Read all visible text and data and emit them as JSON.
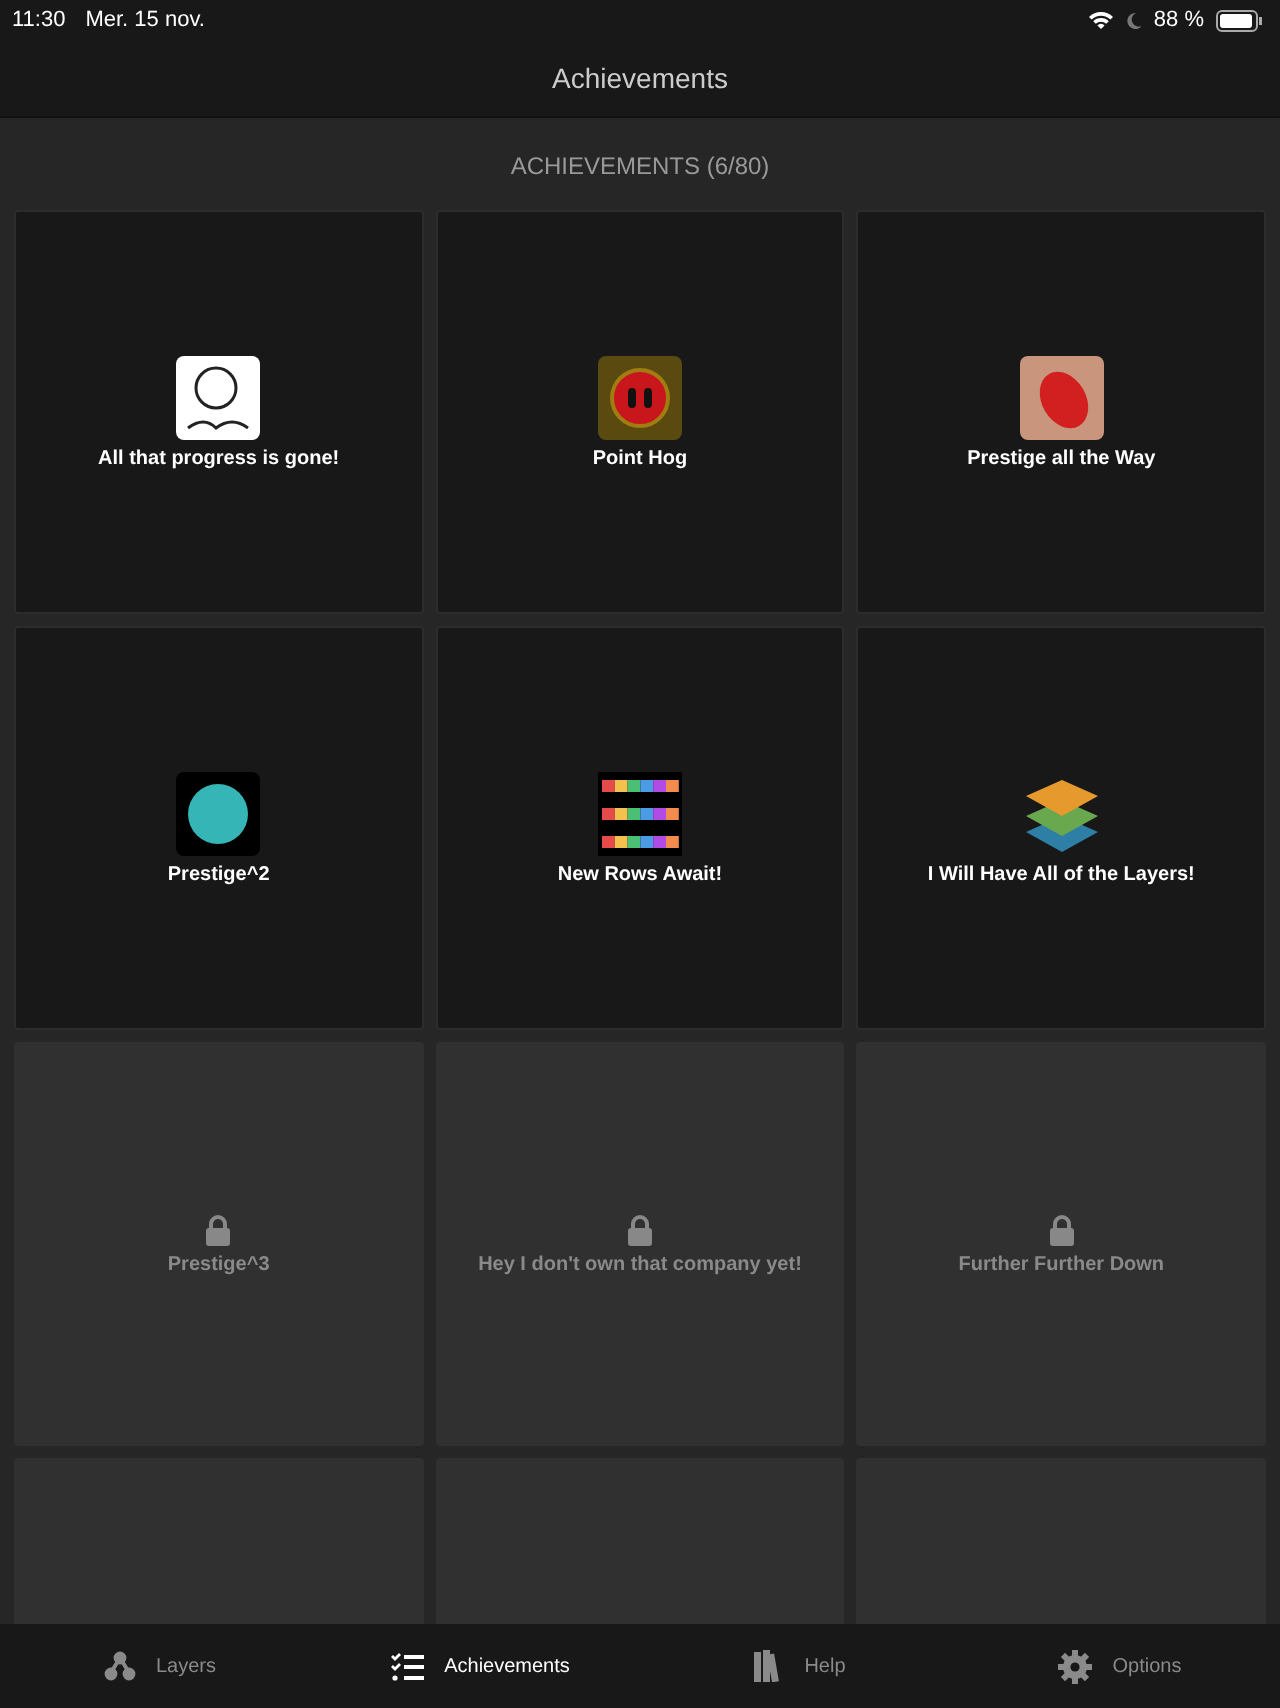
{
  "status_bar": {
    "time": "11:30",
    "date": "Mer. 15 nov.",
    "battery": "88 %"
  },
  "header": {
    "title": "Achievements"
  },
  "section_title": "ACHIEVEMENTS (6/80)",
  "achievements": [
    {
      "title": "All that progress is gone!",
      "unlocked": true
    },
    {
      "title": "Point Hog",
      "unlocked": true
    },
    {
      "title": "Prestige all the Way",
      "unlocked": true
    },
    {
      "title": "Prestige^2",
      "unlocked": true
    },
    {
      "title": "New Rows Await!",
      "unlocked": true
    },
    {
      "title": "I Will Have All of the Layers!",
      "unlocked": true
    },
    {
      "title": "Prestige^3",
      "unlocked": false
    },
    {
      "title": "Hey I don't own that company yet!",
      "unlocked": false
    },
    {
      "title": "Further Further Down",
      "unlocked": false
    },
    {
      "unlocked": false
    },
    {
      "unlocked": false
    },
    {
      "unlocked": false
    }
  ],
  "tabs": [
    {
      "label": "Layers",
      "kind": "layers",
      "selected": false
    },
    {
      "label": "Achievements",
      "kind": "list",
      "selected": true
    },
    {
      "label": "Help",
      "kind": "books",
      "selected": false
    },
    {
      "label": "Options",
      "kind": "gear",
      "selected": false
    }
  ]
}
